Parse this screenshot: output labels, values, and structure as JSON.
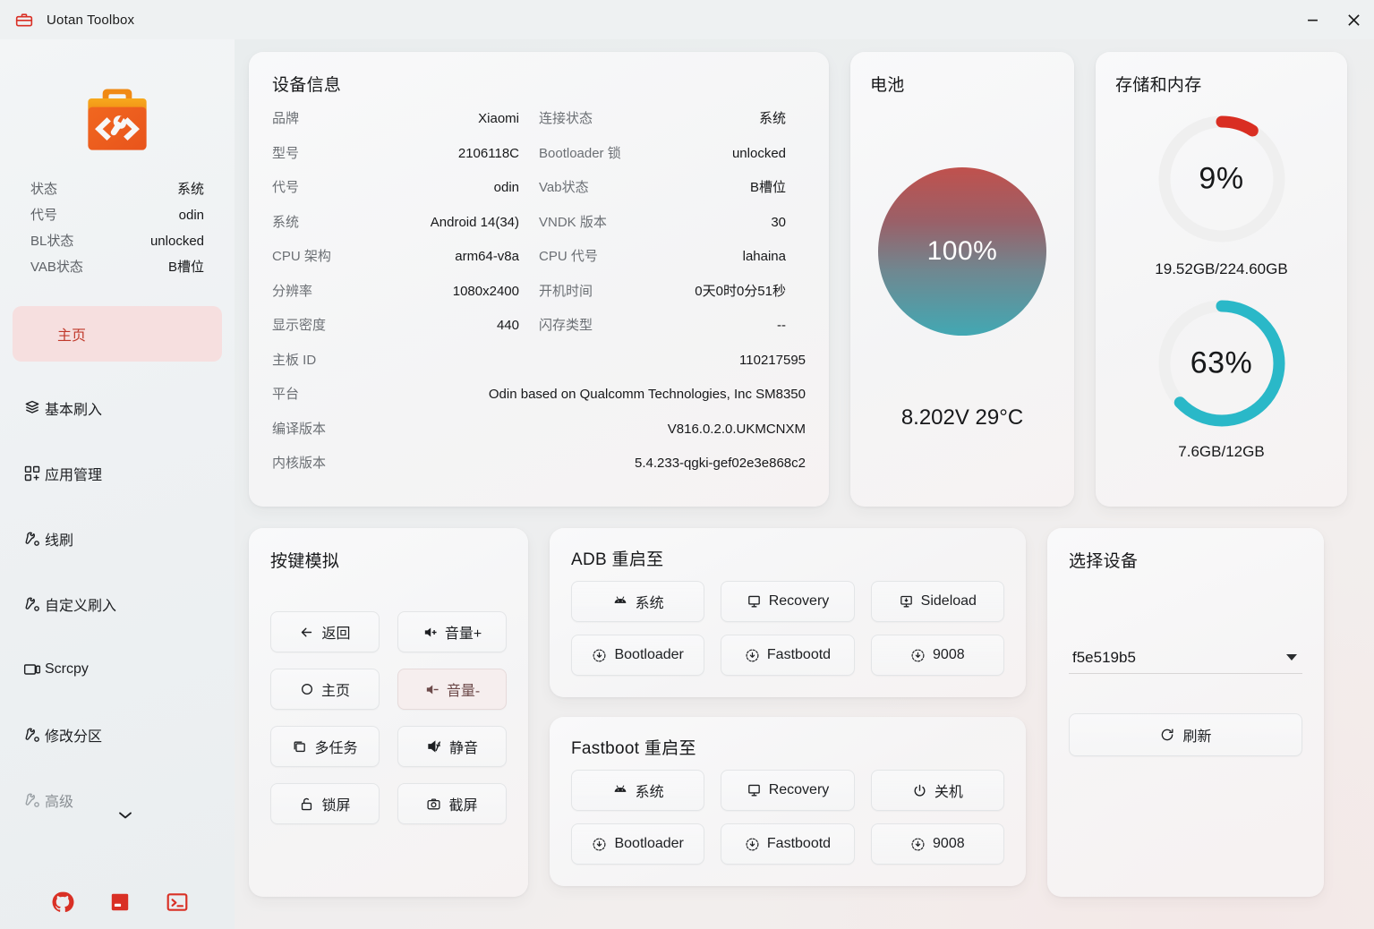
{
  "window": {
    "title": "Uotan Toolbox",
    "icon": "toolbox-icon",
    "minimize_label": "–",
    "close_label": "✕"
  },
  "sidebar": {
    "logo_icon": "toolbox-logo-icon",
    "status": [
      {
        "key": "状态",
        "value": "系统"
      },
      {
        "key": "代号",
        "value": "odin"
      },
      {
        "key": "BL状态",
        "value": "unlocked"
      },
      {
        "key": "VAB状态",
        "value": "B槽位"
      }
    ],
    "items": [
      {
        "label": "主页",
        "icon": "home-icon",
        "active": true
      },
      {
        "label": "基本刷入",
        "icon": "layers-icon",
        "active": false
      },
      {
        "label": "应用管理",
        "icon": "apps-add-icon",
        "active": false
      },
      {
        "label": "线刷",
        "icon": "wrench-gear-icon",
        "active": false
      },
      {
        "label": "自定义刷入",
        "icon": "wrench-gear-icon",
        "active": false
      },
      {
        "label": "Scrcpy",
        "icon": "phone-screen-icon",
        "active": false
      },
      {
        "label": "修改分区",
        "icon": "wrench-gear-icon",
        "active": false
      },
      {
        "label": "高级",
        "icon": "wrench-gear-icon",
        "active": false,
        "dim": true,
        "expandable": true
      }
    ],
    "footer_icons": [
      {
        "name": "github-icon"
      },
      {
        "name": "docs-book-icon"
      },
      {
        "name": "terminal-icon"
      }
    ]
  },
  "device_info": {
    "title": "设备信息",
    "rows": [
      [
        {
          "key": "品牌",
          "value": "Xiaomi"
        },
        {
          "key": "连接状态",
          "value": "系统"
        }
      ],
      [
        {
          "key": "型号",
          "value": "2106118C"
        },
        {
          "key": "Bootloader 锁",
          "value": "unlocked"
        }
      ],
      [
        {
          "key": "代号",
          "value": "odin"
        },
        {
          "key": "Vab状态",
          "value": "B槽位"
        }
      ],
      [
        {
          "key": "系统",
          "value": "Android 14(34)"
        },
        {
          "key": "VNDK 版本",
          "value": "30"
        }
      ],
      [
        {
          "key": "CPU 架构",
          "value": "arm64-v8a"
        },
        {
          "key": "CPU 代号",
          "value": "lahaina"
        }
      ],
      [
        {
          "key": "分辨率",
          "value": "1080x2400"
        },
        {
          "key": "开机时间",
          "value": "0天0时0分51秒"
        }
      ],
      [
        {
          "key": "显示密度",
          "value": "440"
        },
        {
          "key": "闪存类型",
          "value": "--"
        }
      ]
    ],
    "full_rows": [
      {
        "key": "主板 ID",
        "value": "110217595"
      },
      {
        "key": "平台",
        "value": "Odin based on Qualcomm Technologies, Inc SM8350"
      },
      {
        "key": "编译版本",
        "value": "V816.0.2.0.UKMCNXM"
      },
      {
        "key": "内核版本",
        "value": "5.4.233-qgki-gef02e3e868c2"
      }
    ]
  },
  "battery": {
    "title": "电池",
    "percent_label": "100%",
    "percent_value": 100,
    "detail": "8.202V 29°C",
    "gradient_top": "#c0514d",
    "gradient_bottom": "#42a8b3"
  },
  "storage": {
    "title": "存储和内存",
    "disk": {
      "percent_label": "9%",
      "percent_value": 9,
      "caption": "19.52GB/224.60GB",
      "color": "#d92e22"
    },
    "memory": {
      "percent_label": "63%",
      "percent_value": 63,
      "caption": "7.6GB/12GB",
      "color": "#2ab8c8"
    }
  },
  "key_simulation": {
    "title": "按键模拟",
    "buttons": [
      {
        "label": "返回",
        "icon": "arrow-left-icon",
        "hover": false
      },
      {
        "label": "音量+",
        "icon": "volume-up-icon",
        "hover": false
      },
      {
        "label": "主页",
        "icon": "circle-icon",
        "hover": false
      },
      {
        "label": "音量-",
        "icon": "volume-down-icon",
        "hover": true
      },
      {
        "label": "多任务",
        "icon": "multitask-icon",
        "hover": false
      },
      {
        "label": "静音",
        "icon": "volume-mute-icon",
        "hover": false
      },
      {
        "label": "锁屏",
        "icon": "lock-icon",
        "hover": false
      },
      {
        "label": "截屏",
        "icon": "camera-icon",
        "hover": false
      }
    ]
  },
  "adb_reboot": {
    "title": "ADB 重启至",
    "buttons": [
      {
        "label": "系统",
        "icon": "android-icon"
      },
      {
        "label": "Recovery",
        "icon": "monitor-icon"
      },
      {
        "label": "Sideload",
        "icon": "sideload-icon"
      },
      {
        "label": "Bootloader",
        "icon": "download-circle-icon"
      },
      {
        "label": "Fastbootd",
        "icon": "download-circle-icon"
      },
      {
        "label": "9008",
        "icon": "download-circle-icon"
      }
    ]
  },
  "fastboot_reboot": {
    "title": "Fastboot 重启至",
    "buttons": [
      {
        "label": "系统",
        "icon": "android-icon"
      },
      {
        "label": "Recovery",
        "icon": "monitor-icon"
      },
      {
        "label": "关机",
        "icon": "power-icon"
      },
      {
        "label": "Bootloader",
        "icon": "download-circle-icon"
      },
      {
        "label": "Fastbootd",
        "icon": "download-circle-icon"
      },
      {
        "label": "9008",
        "icon": "download-circle-icon"
      }
    ]
  },
  "device_select": {
    "title": "选择设备",
    "selected": "f5e519b5",
    "dropdown_icon": "chevron-down-icon",
    "refresh_label": "刷新",
    "refresh_icon": "refresh-icon"
  }
}
